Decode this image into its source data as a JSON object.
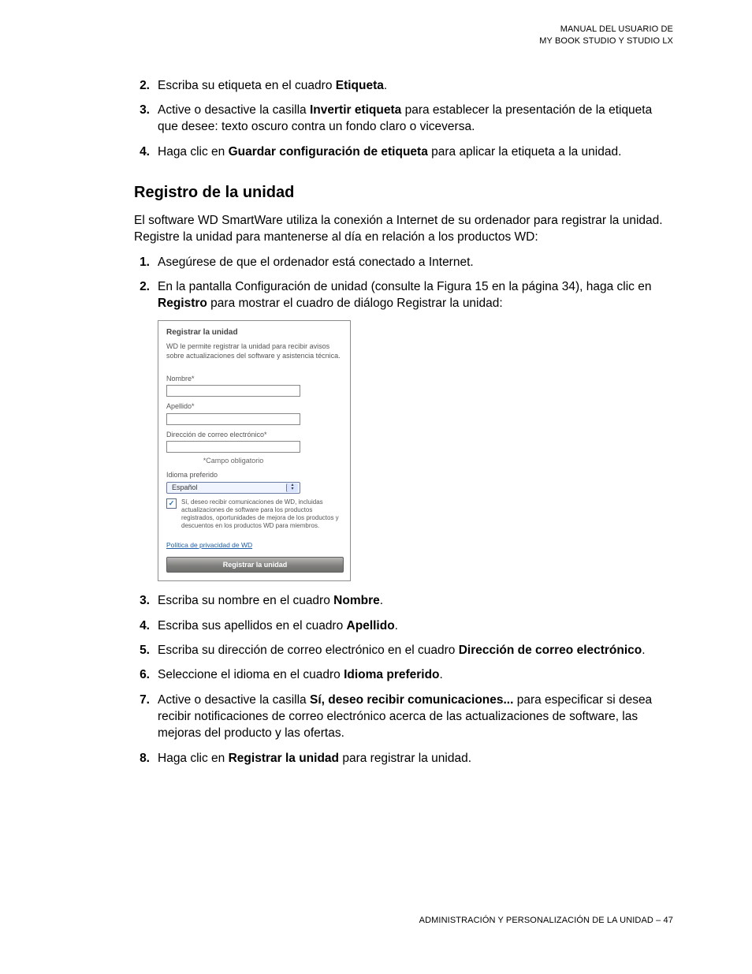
{
  "header": {
    "line1": "MANUAL DEL USUARIO DE",
    "line2": "MY BOOK STUDIO Y STUDIO LX"
  },
  "top_steps": [
    {
      "n": "2.",
      "pre": "Escriba su etiqueta en el cuadro ",
      "bold": "Etiqueta",
      "post": "."
    },
    {
      "n": "3.",
      "pre": "Active o desactive la casilla ",
      "bold": "Invertir etiqueta",
      "post": " para establecer la presentación de la etiqueta que desee: texto oscuro contra un fondo claro o viceversa."
    },
    {
      "n": "4.",
      "pre": "Haga clic en ",
      "bold": "Guardar configuración de etiqueta",
      "post": " para aplicar la etiqueta a la unidad."
    }
  ],
  "section_title": "Registro de la unidad",
  "section_intro": "El software WD SmartWare utiliza la conexión a Internet de su ordenador para registrar la unidad. Registre la unidad para mantenerse al día en relación a los productos WD:",
  "reg_steps_a": [
    {
      "n": "1.",
      "text": "Asegúrese de que el ordenador está conectado a Internet."
    },
    {
      "n": "2.",
      "pre": "En la pantalla Configuración de unidad (consulte la Figura 15 en la página 34), haga clic en ",
      "bold": "Registro",
      "post": " para mostrar el cuadro de diálogo Registrar la unidad:"
    }
  ],
  "dialog": {
    "title": "Registrar la unidad",
    "desc": "WD le permite registrar la unidad para recibir avisos sobre actualizaciones del software y asistencia técnica.",
    "label_name": "Nombre*",
    "label_last": "Apellido*",
    "label_email": "Dirección de correo electrónico*",
    "required": "*Campo obligatorio",
    "label_lang": "Idioma preferido",
    "lang_value": "Español",
    "chk_text": "Sí, deseo recibir comunicaciones de WD, incluidas actualizaciones de software para los productos registrados, oportunidades de mejora de los productos y descuentos en los productos WD para miembros.",
    "privacy": "Política de privacidad de WD",
    "button": "Registrar la unidad"
  },
  "reg_steps_b": [
    {
      "n": "3.",
      "pre": "Escriba su nombre en el cuadro ",
      "bold": "Nombre",
      "post": "."
    },
    {
      "n": "4.",
      "pre": "Escriba sus apellidos en el cuadro ",
      "bold": "Apellido",
      "post": "."
    },
    {
      "n": "5.",
      "pre": "Escriba su dirección de correo electrónico en el cuadro ",
      "bold": "Dirección de correo electrónico",
      "post": "."
    },
    {
      "n": "6.",
      "pre": "Seleccione el idioma en el cuadro ",
      "bold": "Idioma preferido",
      "post": "."
    },
    {
      "n": "7.",
      "pre": "Active o desactive la casilla ",
      "bold": "Sí, deseo recibir comunicaciones...",
      "post": " para especificar si desea recibir notificaciones de correo electrónico acerca de las actualizaciones de software, las mejoras del producto y las ofertas."
    },
    {
      "n": "8.",
      "pre": "Haga clic en ",
      "bold": "Registrar la unidad",
      "post": " para registrar la unidad."
    }
  ],
  "footer": {
    "text": "ADMINISTRACIÓN Y PERSONALIZACIÓN DE LA UNIDAD – 47"
  }
}
